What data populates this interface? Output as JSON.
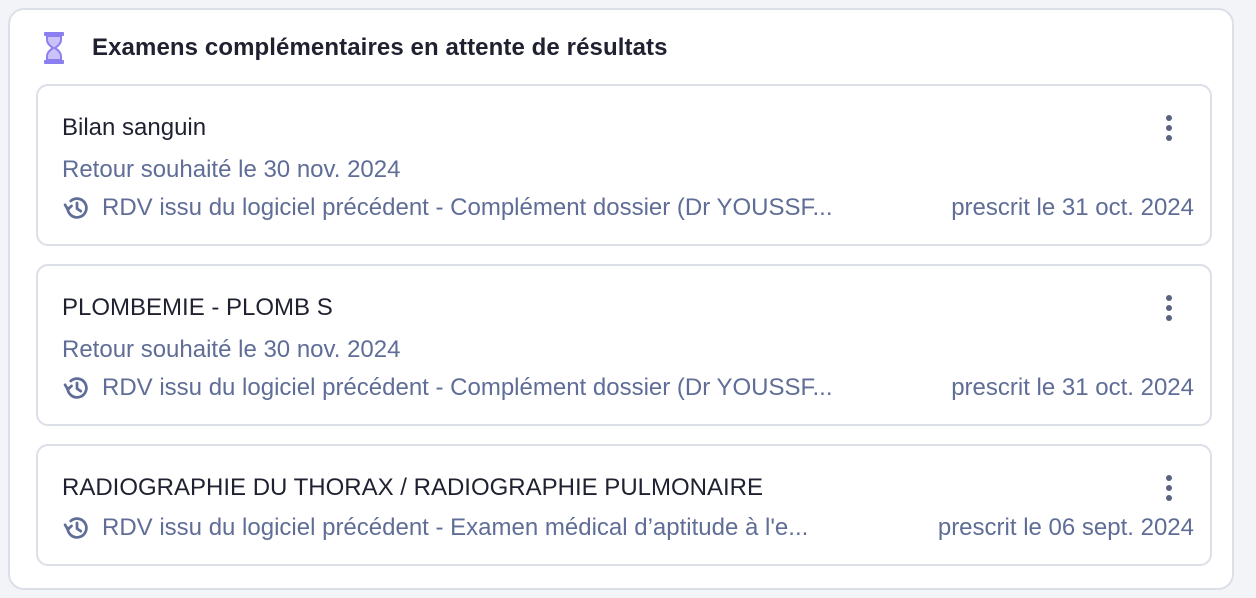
{
  "panel": {
    "title": "Examens complémentaires en attente de résultats",
    "icon": "hourglass-icon",
    "accent_color": "#8b7ff0"
  },
  "exams": [
    {
      "title": "Bilan sanguin",
      "return_date": "Retour souhaité le 30 nov. 2024",
      "origin": "RDV issu du logiciel précédent - Complément dossier (Dr YOUSSF...",
      "prescribed": "prescrit le 31 oct. 2024"
    },
    {
      "title": "PLOMBEMIE - PLOMB S",
      "return_date": "Retour souhaité le 30 nov. 2024",
      "origin": "RDV issu du logiciel précédent - Complément dossier (Dr YOUSSF...",
      "prescribed": "prescrit le 31 oct. 2024"
    },
    {
      "title": "RADIOGRAPHIE DU THORAX / RADIOGRAPHIE PULMONAIRE",
      "return_date": "",
      "origin": "RDV issu du logiciel précédent - Examen médical d’aptitude à l'e...",
      "prescribed": "prescrit le 06 sept. 2024"
    }
  ],
  "colors": {
    "title_text": "#1f2130",
    "secondary_text": "#5f6d97",
    "border": "#dcdfe8"
  }
}
